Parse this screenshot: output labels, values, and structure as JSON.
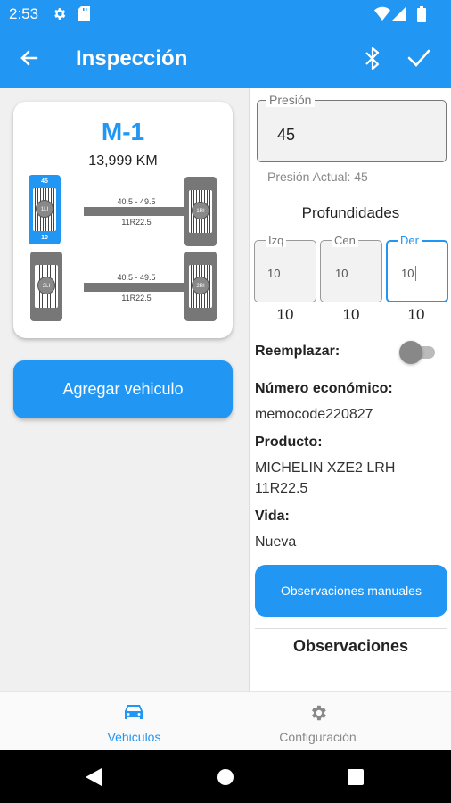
{
  "status_bar": {
    "time": "2:53"
  },
  "app_bar": {
    "title": "Inspección"
  },
  "vehicle": {
    "name": "M-1",
    "km": "13,999 KM",
    "axles": [
      {
        "range": "40.5 - 49.5",
        "size": "11R22.5",
        "left_tire": {
          "code": "1LI",
          "pressure": "45",
          "depth": "10"
        },
        "right_tire": {
          "code": "1RI"
        }
      },
      {
        "range": "40.5 - 49.5",
        "size": "11R22.5",
        "left_tire": {
          "code": "2LI"
        },
        "right_tire": {
          "code": "2RI"
        }
      }
    ]
  },
  "add_vehicle_label": "Agregar vehiculo",
  "pressure": {
    "label": "Presión",
    "value": "45",
    "current": "Presión Actual: 45"
  },
  "depths": {
    "title": "Profundidades",
    "fields": [
      {
        "label": "Izq",
        "input": "10",
        "value": "10"
      },
      {
        "label": "Cen",
        "input": "10",
        "value": "10"
      },
      {
        "label": "Der",
        "input": "10",
        "value": "10"
      }
    ]
  },
  "replace_label": "Reemplazar:",
  "replace_on": false,
  "economic_number": {
    "label": "Número económico:",
    "value": "memocode220827"
  },
  "product": {
    "label": "Producto:",
    "value_line1": "MICHELIN XZE2 LRH",
    "value_line2": "11R22.5"
  },
  "life": {
    "label": "Vida:",
    "value": "Nueva"
  },
  "manual_observations_label": "Observaciones manuales",
  "observations_title": "Observaciones",
  "bottom_nav": {
    "items": [
      {
        "label": "Vehiculos",
        "icon": "car-icon",
        "active": true
      },
      {
        "label": "Configuración",
        "icon": "gear-icon",
        "active": false
      }
    ]
  },
  "colors": {
    "primary": "#2196f3",
    "tire_gray": "#777777",
    "nav_inactive": "#888888"
  }
}
